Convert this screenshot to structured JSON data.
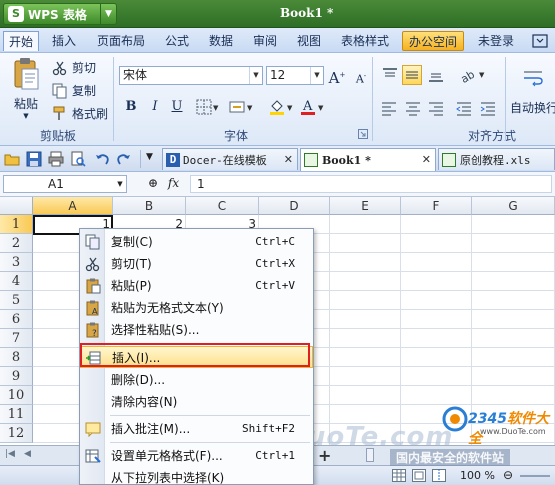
{
  "app": {
    "name": "WPS 表格",
    "document_title": "Book1 *"
  },
  "menu_tabs": [
    "开始",
    "插入",
    "页面布局",
    "公式",
    "数据",
    "审阅",
    "视图",
    "表格样式",
    "办公空间",
    "未登录"
  ],
  "ribbon": {
    "clipboard": {
      "label": "剪贴板",
      "paste": "粘贴",
      "cut": "剪切",
      "copy": "复制",
      "format_painter": "格式刷"
    },
    "font": {
      "label": "字体",
      "family": "宋体",
      "size": "12",
      "bold": "B",
      "italic": "I",
      "underline": "U",
      "grow": "A",
      "shrink": "A"
    },
    "alignment": {
      "label": "对齐方式",
      "wrap": "自动换行"
    }
  },
  "doc_tabs": [
    {
      "label": "Docer-在线模板",
      "close": "✕"
    },
    {
      "label": "Book1 *",
      "close": "✕"
    },
    {
      "label": "原创教程.xls"
    }
  ],
  "formula_bar": {
    "cell_ref": "A1",
    "fx": "fx",
    "value": "1"
  },
  "grid": {
    "columns": [
      "A",
      "B",
      "C",
      "D",
      "E",
      "F",
      "G"
    ],
    "rows": [
      "1",
      "2",
      "3",
      "4",
      "5",
      "6",
      "7",
      "8",
      "9",
      "10",
      "11",
      "12"
    ],
    "row1_values": [
      "1",
      "2",
      "3"
    ]
  },
  "context_menu": [
    {
      "label": "复制(C)",
      "shortcut": "Ctrl+C",
      "icon": "copy-icon"
    },
    {
      "label": "剪切(T)",
      "shortcut": "Ctrl+X",
      "icon": "scissors-icon"
    },
    {
      "label": "粘贴(P)",
      "shortcut": "Ctrl+V",
      "icon": "paste-icon"
    },
    {
      "label": "粘贴为无格式文本(Y)",
      "shortcut": "",
      "icon": "paste-text-icon"
    },
    {
      "label": "选择性粘贴(S)...",
      "shortcut": "",
      "icon": "paste-special-icon"
    },
    {
      "label": "插入(I)...",
      "shortcut": "",
      "icon": "insert-cells-icon"
    },
    {
      "label": "删除(D)...",
      "shortcut": "",
      "icon": ""
    },
    {
      "label": "清除内容(N)",
      "shortcut": "",
      "icon": ""
    },
    {
      "label": "插入批注(M)...",
      "shortcut": "Shift+F2",
      "icon": "comment-icon"
    },
    {
      "label": "设置单元格格式(F)...",
      "shortcut": "Ctrl+1",
      "icon": "format-cells-icon"
    },
    {
      "label": "从下拉列表中选择(K)",
      "shortcut": "",
      "icon": ""
    }
  ],
  "status_bar": {
    "zoom": "100 %"
  },
  "watermark": {
    "text": "www.DuoTe.com",
    "brand": "2345",
    "brand_suffix": "软件大全",
    "site": "www.DuoTe.com",
    "slogan": "国内最安全的软件站"
  },
  "colors": {
    "title_bar": "#2f6e26",
    "accent": "#ffe08a",
    "highlight_border": "#e02020"
  }
}
